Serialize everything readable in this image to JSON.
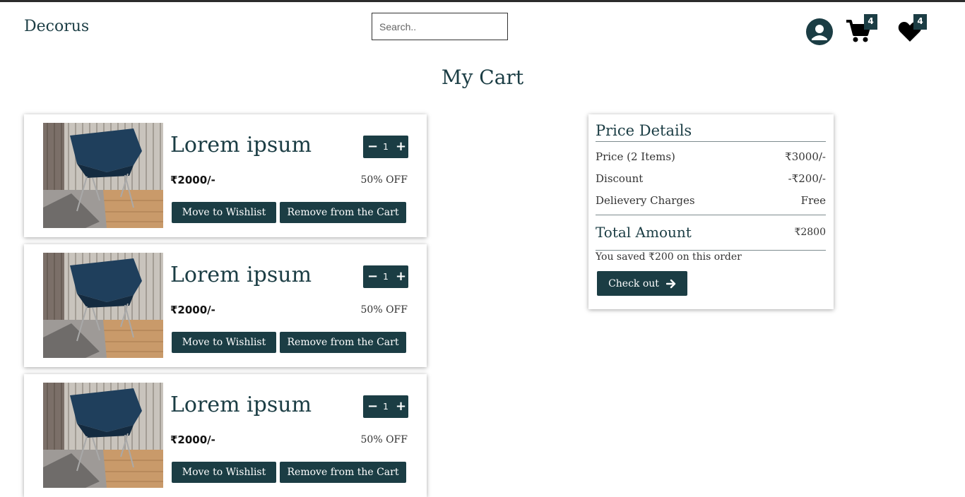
{
  "header": {
    "brand": "Decorus",
    "search_placeholder": "Search..",
    "cart_count": "4",
    "wishlist_count": "4",
    "icons": [
      "user-icon",
      "cart-icon",
      "heart-icon"
    ]
  },
  "page_title": "My Cart",
  "cart_items": [
    {
      "name": "Lorem ipsum",
      "qty": "1",
      "price": "₹2000/-",
      "discount": "50% OFF",
      "wishlist_label": "Move to Wishlist",
      "remove_label": "Remove from the Cart"
    },
    {
      "name": "Lorem ipsum",
      "qty": "1",
      "price": "₹2000/-",
      "discount": "50% OFF",
      "wishlist_label": "Move to Wishlist",
      "remove_label": "Remove from the Cart"
    },
    {
      "name": "Lorem ipsum",
      "qty": "1",
      "price": "₹2000/-",
      "discount": "50% OFF",
      "wishlist_label": "Move to Wishlist",
      "remove_label": "Remove from the Cart"
    }
  ],
  "price_details": {
    "title": "Price Details",
    "price_label": "Price (2 Items)",
    "price_value": "₹3000/-",
    "discount_label": "Discount",
    "discount_value": "-₹200/-",
    "delivery_label": "Delievery Charges",
    "delivery_value": "Free",
    "total_label": "Total Amount",
    "total_value": "₹2800",
    "saved_text": "You saved ₹200 on this order",
    "checkout_label": "Check out"
  },
  "colors": {
    "accent": "#1b3d44",
    "background": "#ffffff"
  }
}
